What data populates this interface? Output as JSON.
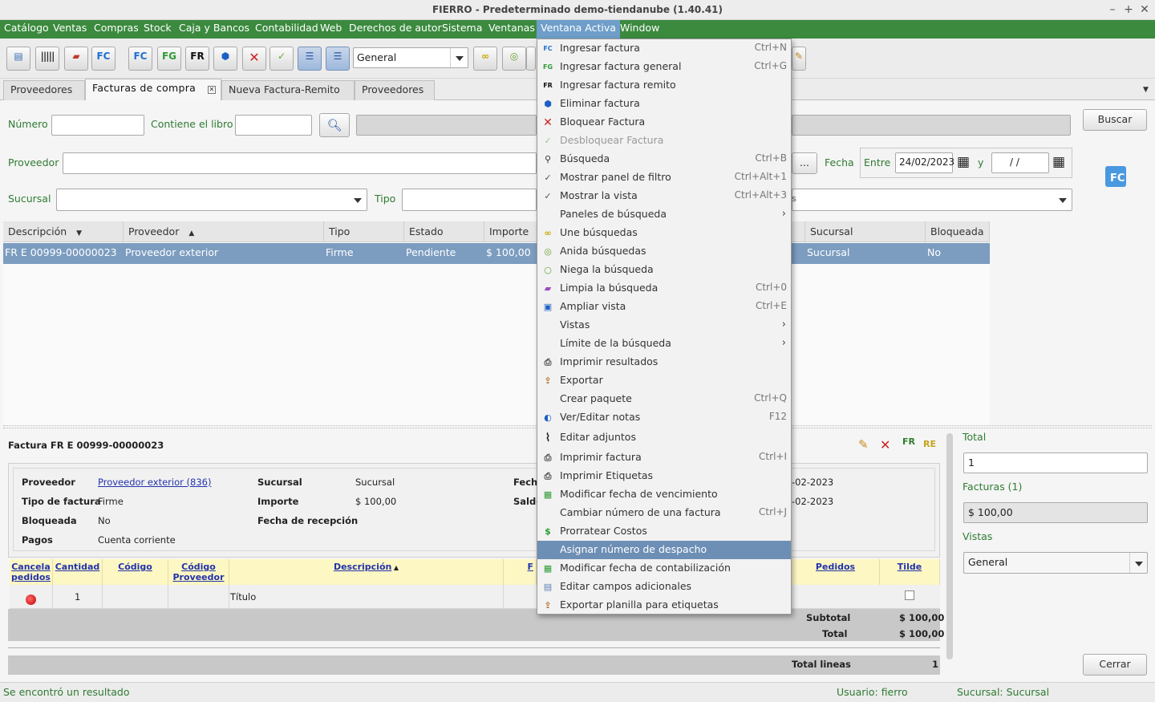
{
  "window": {
    "title": "FIERRO - Predeterminado demo-tiendanube (1.40.41)"
  },
  "menubar": [
    "Catálogo",
    "Ventas",
    "Compras",
    "Stock",
    "Caja y Bancos",
    "Contabilidad",
    "Web",
    "Derechos de autor",
    "Sistema",
    "Ventanas",
    "Ventana Activa",
    "Window"
  ],
  "toolbar": {
    "view_combo": "General"
  },
  "tabs": [
    "Proveedores",
    "Facturas de compra",
    "Nueva Factura-Remito",
    "Proveedores"
  ],
  "filters": {
    "numero_label": "Número",
    "contiene_label": "Contiene el libro",
    "proveedor_label": "Proveedor",
    "sucursal_label": "Sucursal",
    "tipo_label": "Tipo",
    "fecha_label": "Fecha",
    "entre_label": "Entre",
    "fecha_desde": "24/02/2023",
    "y_label": "y",
    "fecha_hasta": " /  /",
    "dots": "...",
    "estado_partial": "s",
    "buscar": "Buscar"
  },
  "grid": {
    "headers": [
      "Descripción",
      "Proveedor",
      "Tipo",
      "Estado",
      "Importe",
      "Sucursal",
      "Bloqueada"
    ],
    "row": {
      "descripcion": "FR E 00999-00000023",
      "proveedor": "Proveedor exterior",
      "tipo": "Firme",
      "estado": "Pendiente",
      "importe": "$ 100,00",
      "sucursal": "Sucursal",
      "bloqueada": "No"
    }
  },
  "detail": {
    "title": "Factura FR E 00999-00000023",
    "proveedor_label": "Proveedor",
    "proveedor_value": "Proveedor exterior (836)",
    "sucursal_label": "Sucursal",
    "sucursal_value": "Sucursal",
    "fecha_label": "Fech",
    "fecha_value_1": "-02-2023",
    "tipo_label": "Tipo de factura",
    "tipo_value": "Firme",
    "importe_label": "Importe",
    "importe_value": "$ 100,00",
    "saldo_label": "Saldo",
    "fecha_value_2": "-02-2023",
    "bloqueada_label": "Bloqueada",
    "bloqueada_value": "No",
    "recepcion_label": "Fecha de recepción",
    "pagos_label": "Pagos",
    "pagos_value": "Cuenta corriente",
    "columns": {
      "cancela": "Cancela",
      "pedidos_sub": "pedidos",
      "cantidad": "Cantidad",
      "codigo": "Código",
      "codigo_prov_1": "Código",
      "codigo_prov_2": "Proveedor",
      "descripcion": "Descripción",
      "partial": "F",
      "pedidos": "Pedidos",
      "tilde": "Tilde"
    },
    "item": {
      "cantidad": "1",
      "descripcion": "Título"
    },
    "subtotal_label": "Subtotal",
    "subtotal_value": "$ 100,00",
    "total_label": "Total",
    "total_value": "$ 100,00",
    "total_lineas_label": "Total lineas",
    "total_lineas_value": "1"
  },
  "right_panel": {
    "total_label": "Total",
    "total_value": "1",
    "facturas_label": "Facturas (1)",
    "facturas_value": "$ 100,00",
    "vistas_label": "Vistas",
    "vistas_value": "General",
    "cerrar": "Cerrar"
  },
  "status": {
    "message": "Se encontró un resultado",
    "usuario": "Usuario: fierro",
    "sucursal": "Sucursal: Sucursal"
  },
  "menu": {
    "items": [
      {
        "label": "Ingresar factura",
        "shortcut": "Ctrl+N"
      },
      {
        "label": "Ingresar factura general",
        "shortcut": "Ctrl+G"
      },
      {
        "label": "Ingresar factura remito",
        "shortcut": ""
      },
      {
        "label": "Eliminar factura",
        "shortcut": ""
      },
      {
        "label": "Bloquear Factura",
        "shortcut": ""
      },
      {
        "label": "Desbloquear Factura",
        "shortcut": ""
      },
      {
        "label": "Búsqueda",
        "shortcut": "Ctrl+B"
      },
      {
        "label": "Mostrar panel de filtro",
        "shortcut": "Ctrl+Alt+1"
      },
      {
        "label": "Mostrar la vista",
        "shortcut": "Ctrl+Alt+3"
      },
      {
        "label": "Paneles de búsqueda",
        "shortcut": ""
      },
      {
        "label": "Une búsquedas",
        "shortcut": ""
      },
      {
        "label": "Anida búsquedas",
        "shortcut": ""
      },
      {
        "label": "Niega la búsqueda",
        "shortcut": ""
      },
      {
        "label": "Limpia la búsqueda",
        "shortcut": "Ctrl+0"
      },
      {
        "label": "Ampliar vista",
        "shortcut": "Ctrl+E"
      },
      {
        "label": "Vistas",
        "shortcut": ""
      },
      {
        "label": "Límite de la búsqueda",
        "shortcut": ""
      },
      {
        "label": "Imprimir resultados",
        "shortcut": ""
      },
      {
        "label": "Exportar",
        "shortcut": ""
      },
      {
        "label": "Crear paquete",
        "shortcut": "Ctrl+Q"
      },
      {
        "label": "Ver/Editar notas",
        "shortcut": "F12"
      },
      {
        "label": "Editar adjuntos",
        "shortcut": ""
      },
      {
        "label": "Imprimir factura",
        "shortcut": "Ctrl+I"
      },
      {
        "label": "Imprimir Etiquetas",
        "shortcut": ""
      },
      {
        "label": "Modificar fecha de vencimiento",
        "shortcut": ""
      },
      {
        "label": "Cambiar número de una factura",
        "shortcut": "Ctrl+J"
      },
      {
        "label": "Prorratear Costos",
        "shortcut": ""
      },
      {
        "label": "Asignar número de despacho",
        "shortcut": ""
      },
      {
        "label": "Modificar fecha de contabilización",
        "shortcut": ""
      },
      {
        "label": "Editar campos adicionales",
        "shortcut": ""
      },
      {
        "label": "Exportar planilla para etiquetas",
        "shortcut": ""
      }
    ]
  }
}
